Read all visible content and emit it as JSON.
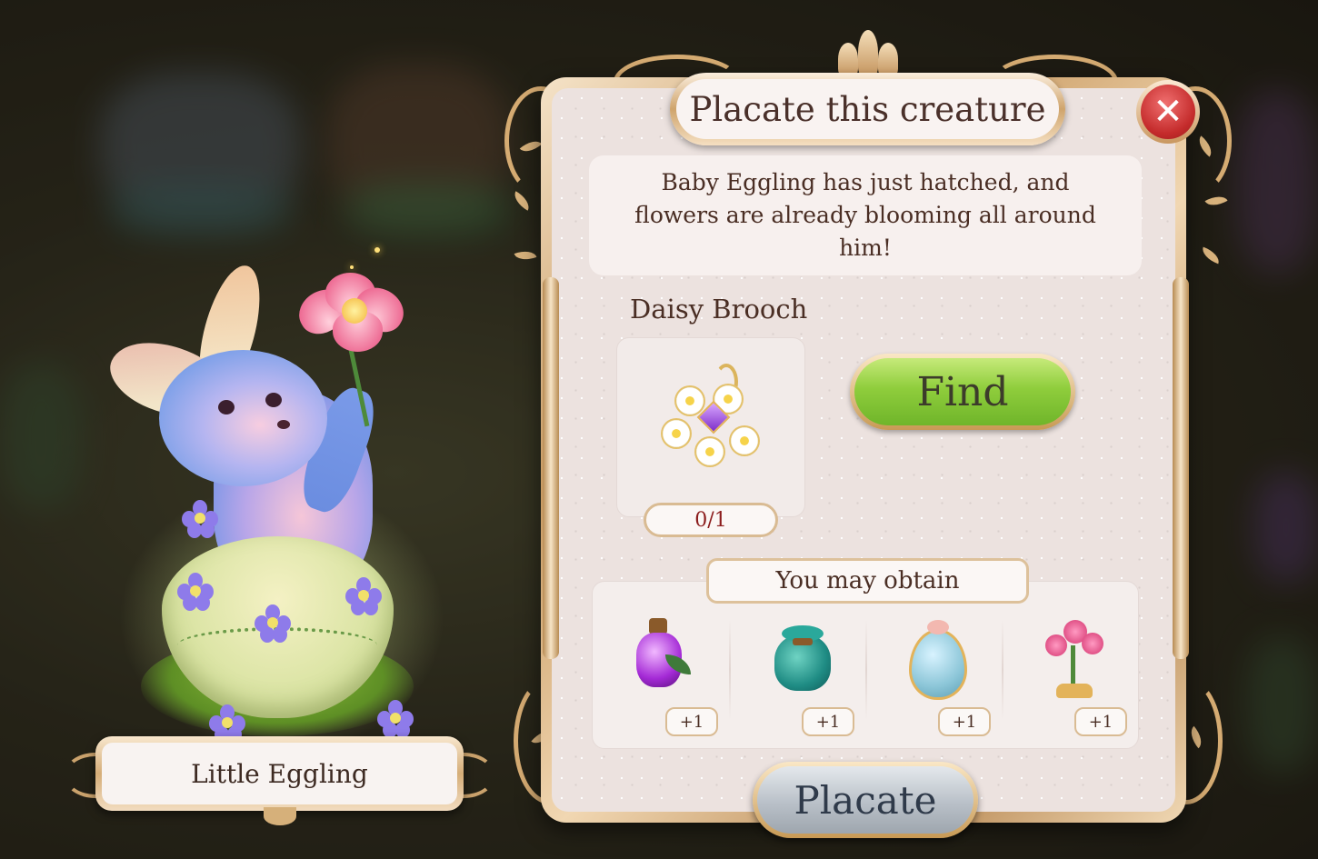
{
  "dialog": {
    "title": "Placate this creature",
    "description": "Baby Eggling has just hatched, and flowers are already blooming all around him!",
    "requirement": {
      "item_name": "Daisy Brooch",
      "item_icon": "daisy-brooch-icon",
      "progress": "0/1"
    },
    "find_label": "Find",
    "obtain_label": "You may obtain",
    "rewards": [
      {
        "icon": "potion-bottle-icon",
        "amount": "+1"
      },
      {
        "icon": "pouch-bag-icon",
        "amount": "+1"
      },
      {
        "icon": "decorated-egg-icon",
        "amount": "+1"
      },
      {
        "icon": "raspberry-plant-icon",
        "amount": "+1"
      }
    ],
    "placate_label": "Placate",
    "close_icon": "close-icon"
  },
  "creature": {
    "name": "Little Eggling"
  },
  "colors": {
    "find_button": "#8fcd3c",
    "close_button": "#c42b2b",
    "placate_button": "#b9c0c8",
    "frame_gold": "#c99b63",
    "progress_text": "#8b1c1c"
  }
}
